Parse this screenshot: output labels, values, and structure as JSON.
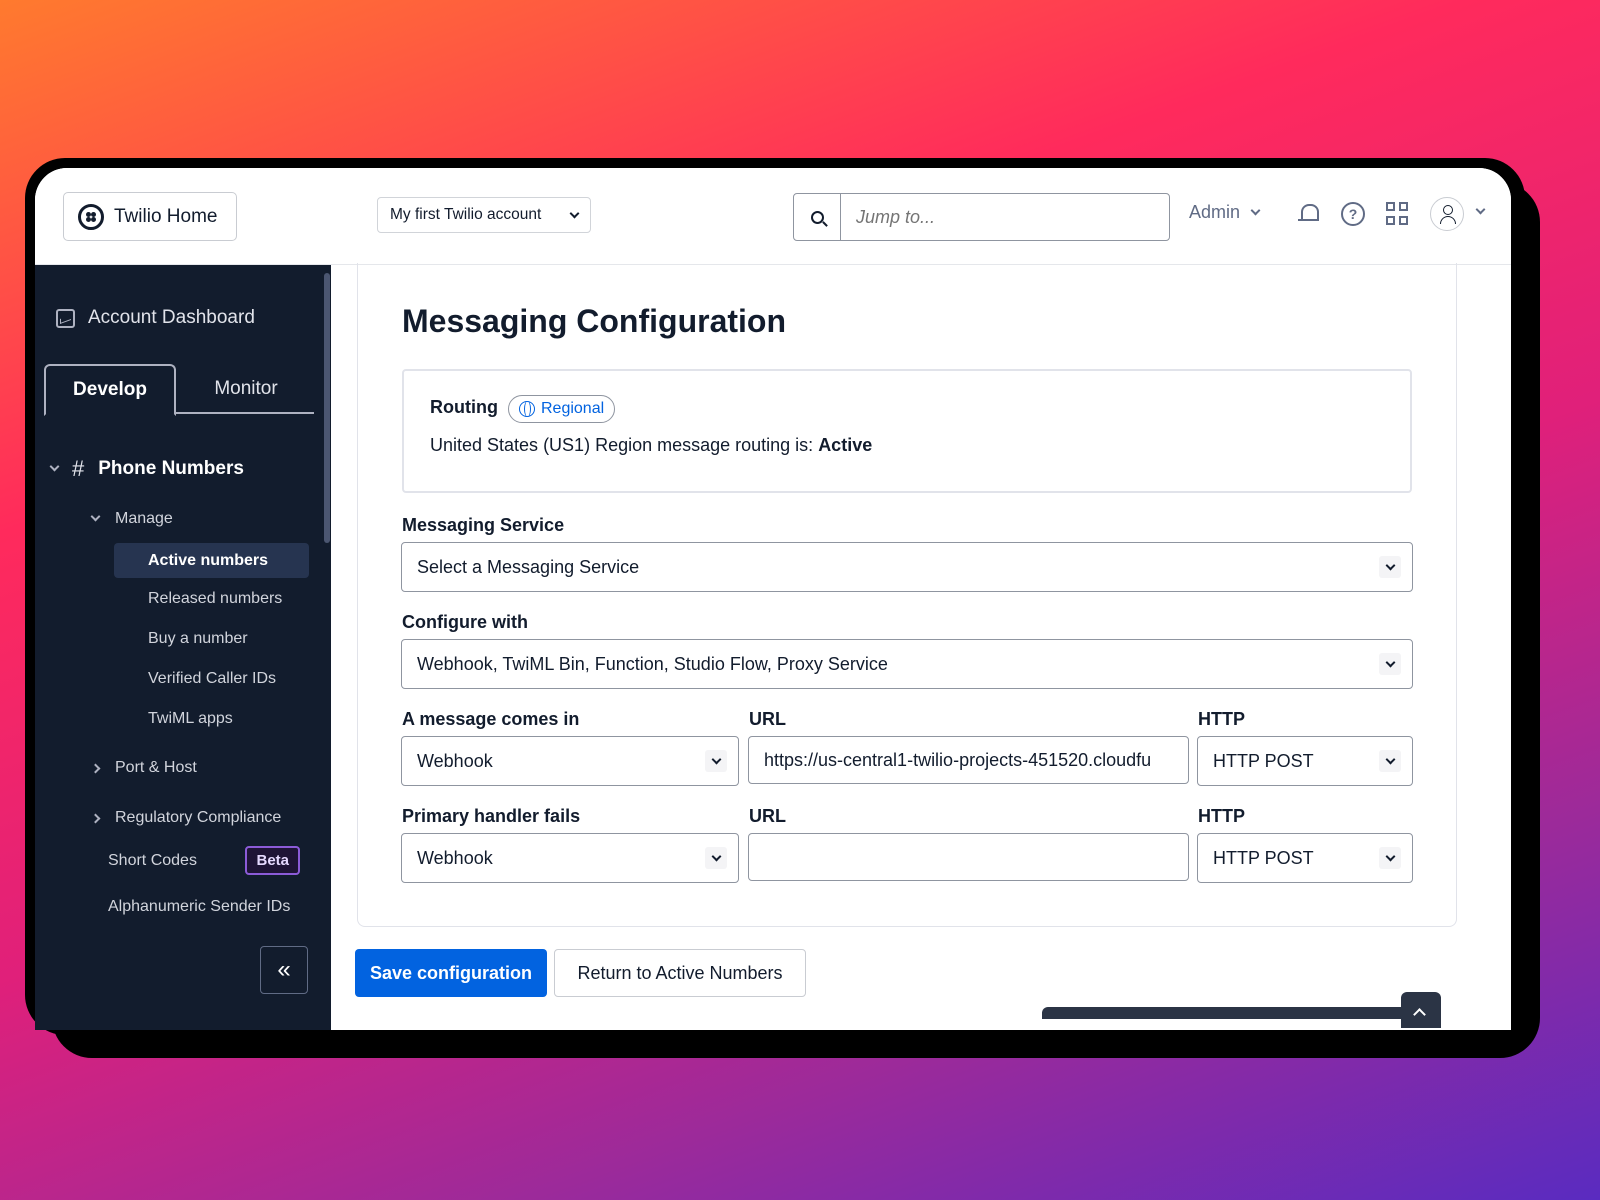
{
  "header": {
    "home_label": "Twilio Home",
    "account_label": "My first Twilio account",
    "search_placeholder": "Jump to...",
    "role_label": "Admin",
    "icons": [
      "bell-icon",
      "help-icon",
      "apps-grid-icon",
      "user-icon"
    ]
  },
  "sidebar": {
    "dashboard_label": "Account Dashboard",
    "tabs": [
      {
        "label": "Develop",
        "active": true
      },
      {
        "label": "Monitor",
        "active": false
      }
    ],
    "section": {
      "hash": "#",
      "title": "Phone Numbers",
      "manage_label": "Manage",
      "manage_items": [
        "Active numbers",
        "Released numbers",
        "Buy a number",
        "Verified Caller IDs",
        "TwiML apps"
      ],
      "active_item": "Active numbers",
      "port_host": "Port & Host",
      "regulatory": "Regulatory Compliance",
      "short_codes": "Short Codes",
      "beta_badge": "Beta",
      "alphanumeric": "Alphanumeric Sender IDs"
    },
    "collapse_glyph": "«"
  },
  "main": {
    "title": "Messaging Configuration",
    "routing": {
      "label": "Routing",
      "badge": "Regional",
      "text_prefix": "United States (US1) Region message routing is: ",
      "status": "Active"
    },
    "messaging_service": {
      "label": "Messaging Service",
      "value": "Select a Messaging Service"
    },
    "configure_with": {
      "label": "Configure with",
      "value": "Webhook, TwiML Bin, Function, Studio Flow, Proxy Service"
    },
    "message_comes_in": {
      "label": "A message comes in",
      "type_value": "Webhook",
      "url_label": "URL",
      "url_value": "https://us-central1-twilio-projects-451520.cloudfu",
      "http_label": "HTTP",
      "http_value": "HTTP POST"
    },
    "primary_handler_fails": {
      "label": "Primary handler fails",
      "type_value": "Webhook",
      "url_label": "URL",
      "url_value": "",
      "http_label": "HTTP",
      "http_value": "HTTP POST"
    },
    "save_label": "Save configuration",
    "return_label": "Return to Active Numbers"
  },
  "colors": {
    "sidebar_bg": "#121c2d",
    "primary": "#0263e0",
    "beta_border": "#8c5bd8"
  }
}
